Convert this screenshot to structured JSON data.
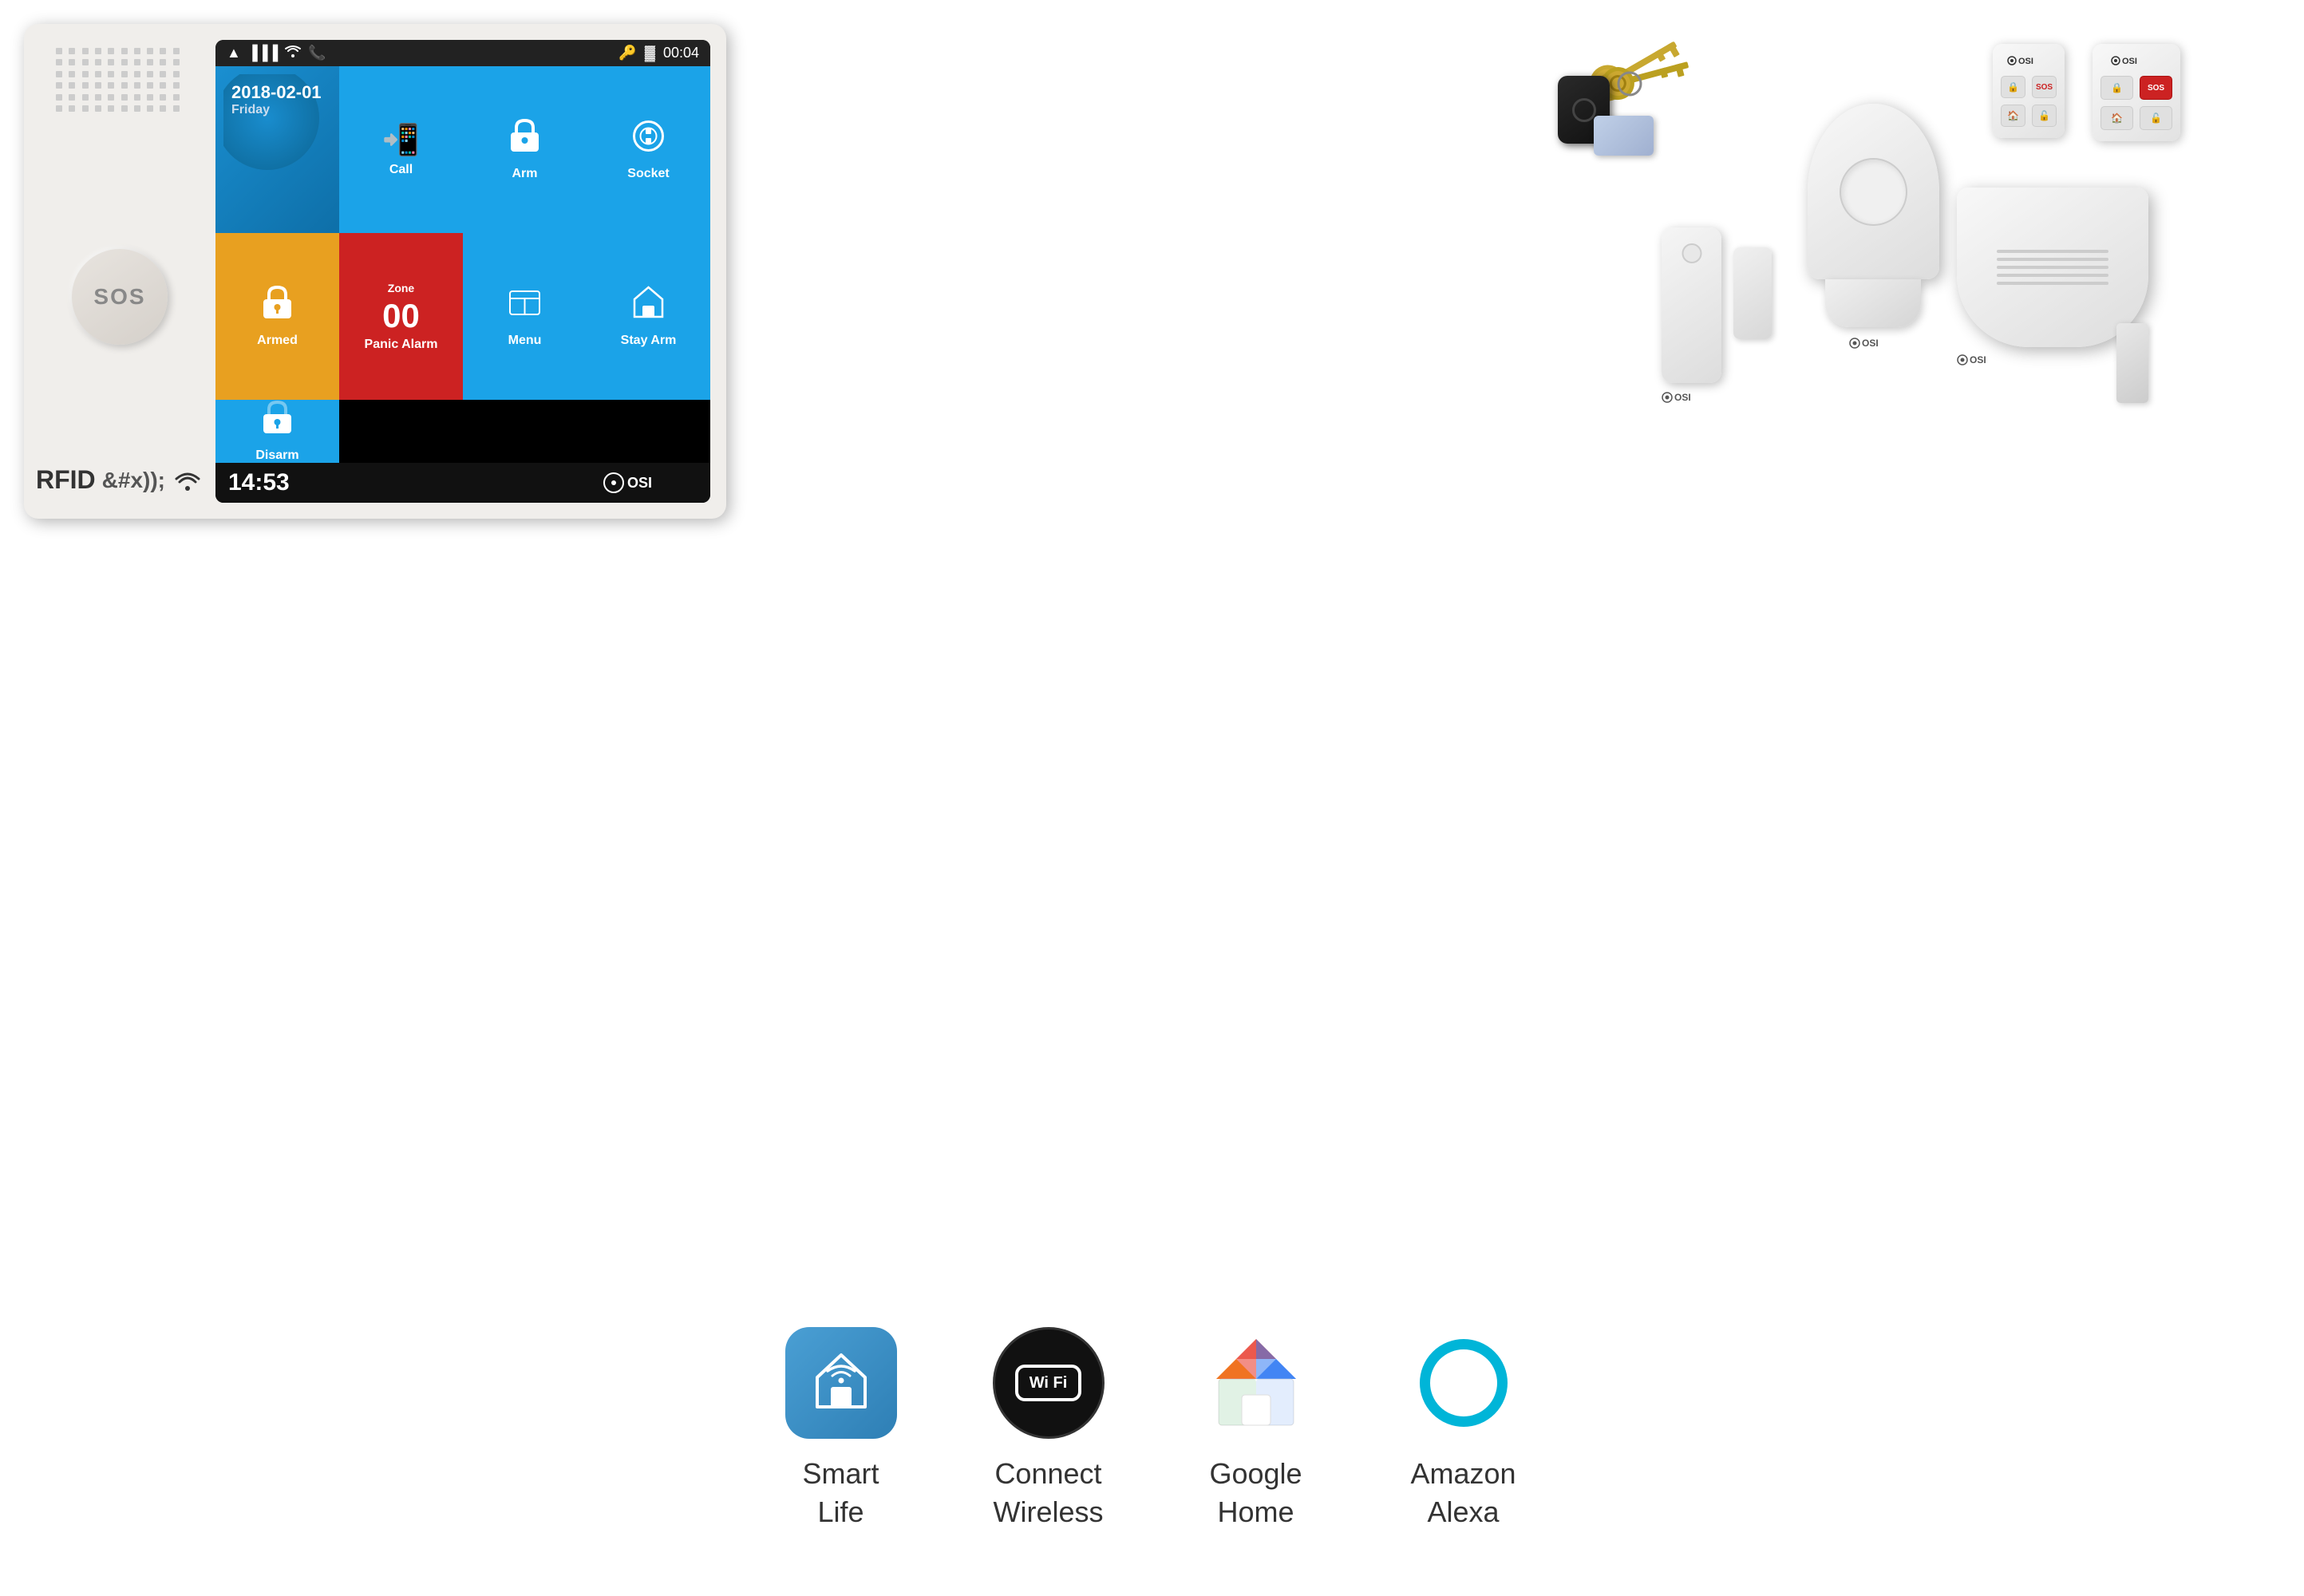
{
  "panel": {
    "rfid_label": "RFID",
    "sos_label": "SOS",
    "status_bar": {
      "left_icons": [
        "signal",
        "wifi",
        "phone"
      ],
      "right_icons": [
        "key",
        "battery"
      ],
      "time": "00:04"
    },
    "screen": {
      "date": "2018-02-01",
      "day": "Friday",
      "tiles": [
        {
          "id": "call",
          "label": "Call",
          "icon": "📞"
        },
        {
          "id": "arm",
          "label": "Arm",
          "icon": "🔒"
        },
        {
          "id": "socket",
          "label": "Socket",
          "icon": "⊙"
        },
        {
          "id": "armed",
          "label": "Armed",
          "icon": "🔒"
        },
        {
          "id": "panic",
          "label": "Panic Alarm",
          "zone": "Zone",
          "number": "00"
        },
        {
          "id": "menu",
          "label": "Menu",
          "icon": "▦"
        },
        {
          "id": "stay_arm",
          "label": "Stay Arm",
          "icon": "🏠"
        },
        {
          "id": "disarm",
          "label": "Disarm",
          "icon": "🔓"
        }
      ],
      "clock": "14:53",
      "osi_logo": "OSI"
    }
  },
  "accessories": {
    "pir_brand": "OSI",
    "door_brand": "OSI",
    "siren_brand": "OSI",
    "remote1_brand": "OSI",
    "remote2_brand": "OSI",
    "remote1_buttons": [
      "🔒",
      "SOS",
      "🏠",
      "🔓"
    ],
    "remote2_buttons": [
      "🔒",
      "SOS",
      "🏠",
      "🔓"
    ]
  },
  "features": [
    {
      "id": "smart-life",
      "label": "Smart\nLife",
      "label_line1": "Smart",
      "label_line2": "Life"
    },
    {
      "id": "connect-wireless",
      "label": "Connect\nWireless",
      "label_line1": "Connect",
      "label_line2": "Wireless"
    },
    {
      "id": "google-home",
      "label": "Google\nHome",
      "label_line1": "Google",
      "label_line2": "Home"
    },
    {
      "id": "amazon-alexa",
      "label": "Amazon\nAlexa",
      "label_line1": "Amazon",
      "label_line2": "Alexa"
    }
  ],
  "wifi_text": "Wi Fi",
  "colors": {
    "tile_blue": "#1ba3e8",
    "tile_orange": "#e8a020",
    "tile_red": "#cc2222",
    "smart_life_blue": "#4a9fd4",
    "alexa_cyan": "#00b5d8",
    "panel_bg": "#f0eeeb"
  }
}
